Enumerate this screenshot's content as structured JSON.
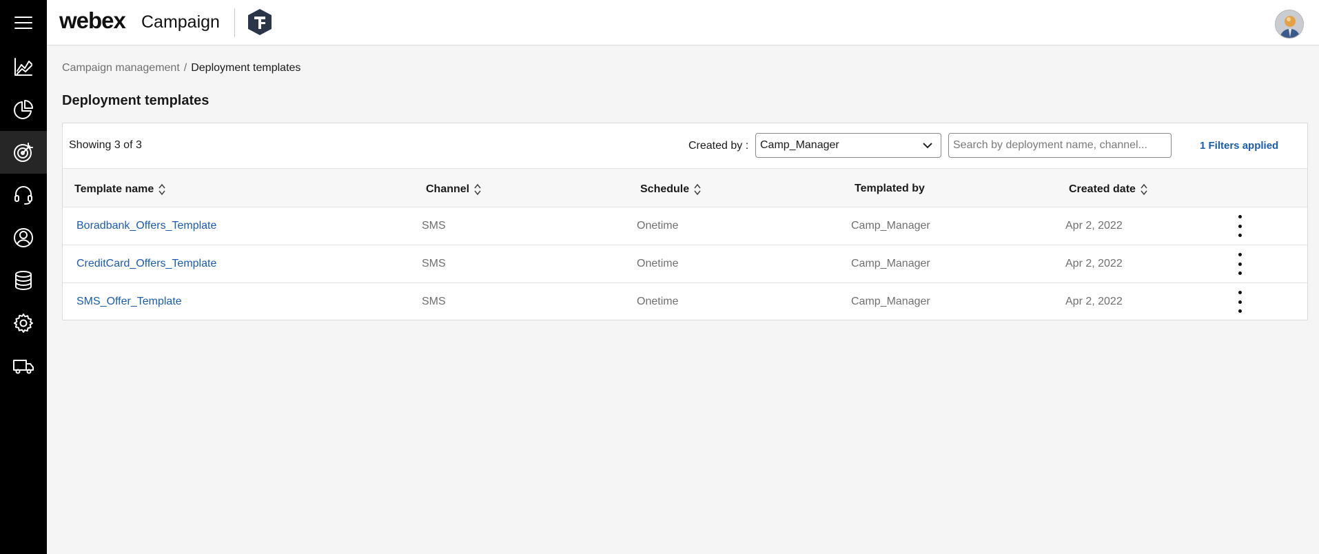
{
  "app": {
    "brand": "webex",
    "product": "Campaign"
  },
  "rail": {
    "items": [
      {
        "icon": "menu-icon"
      },
      {
        "icon": "analytics-icon"
      },
      {
        "icon": "pie-chart-icon"
      },
      {
        "icon": "campaign-target-icon",
        "active": true
      },
      {
        "icon": "headset-icon"
      },
      {
        "icon": "contact-icon"
      },
      {
        "icon": "database-icon"
      },
      {
        "icon": "gear-icon"
      },
      {
        "icon": "delivery-truck-icon"
      }
    ]
  },
  "breadcrumb": {
    "parent": "Campaign management",
    "separator": "/",
    "current": "Deployment templates"
  },
  "page": {
    "title": "Deployment templates"
  },
  "toolbar": {
    "showing": "Showing 3 of 3",
    "created_by_label": "Created by :",
    "created_by_value": "Camp_Manager",
    "search_placeholder": "Search by deployment name, channel...",
    "filters_applied": "1 Filters applied"
  },
  "table": {
    "columns": [
      {
        "label": "Template name",
        "sortable": true
      },
      {
        "label": "Channel",
        "sortable": true
      },
      {
        "label": "Schedule",
        "sortable": true
      },
      {
        "label": "Templated by",
        "sortable": false
      },
      {
        "label": "Created date",
        "sortable": true
      }
    ],
    "rows": [
      {
        "name": "Boradbank_Offers_Template",
        "channel": "SMS",
        "schedule": "Onetime",
        "templated_by": "Camp_Manager",
        "created": "Apr 2, 2022"
      },
      {
        "name": "CreditCard_Offers_Template",
        "channel": "SMS",
        "schedule": "Onetime",
        "templated_by": "Camp_Manager",
        "created": "Apr 2, 2022"
      },
      {
        "name": "SMS_Offer_Template",
        "channel": "SMS",
        "schedule": "Onetime",
        "templated_by": "Camp_Manager",
        "created": "Apr 2, 2022"
      }
    ]
  },
  "colors": {
    "link": "#1a5cb0",
    "rail": "#000000",
    "rail_active": "#262626"
  }
}
